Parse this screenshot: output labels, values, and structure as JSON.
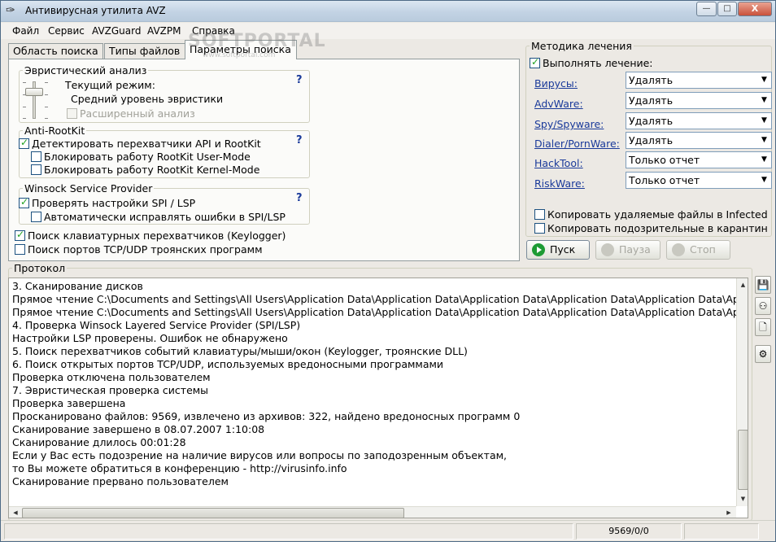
{
  "window": {
    "title": "Антивирусная утилита AVZ",
    "buttons": {
      "minimize": "—",
      "maximize": "□",
      "close": "X"
    }
  },
  "menu": {
    "items": [
      {
        "label": "Файл"
      },
      {
        "label": "Сервис"
      },
      {
        "label": "AVZGuard"
      },
      {
        "label": "AVZPM"
      },
      {
        "label": "Справка"
      }
    ]
  },
  "watermark": {
    "text": "SOFTPORTAL",
    "sub": "www.softportal.com"
  },
  "tabs": [
    {
      "label": "Область поиска",
      "active": false
    },
    {
      "label": "Типы файлов",
      "active": false
    },
    {
      "label": "Параметры поиска",
      "active": true
    }
  ],
  "heuristic": {
    "legend": "Эвристический анализ",
    "help": "?",
    "mode_label": "Текущий режим:",
    "mode_value": "Средний уровень эвристики",
    "extended": {
      "label": "Расширенный анализ",
      "checked": false,
      "disabled": true
    }
  },
  "antirootkit": {
    "legend": "Anti-RootKit",
    "help": "?",
    "detect": {
      "label": "Детектировать перехватчики API и RootKit",
      "checked": true
    },
    "block_user": {
      "label": "Блокировать работу RootKit User-Mode",
      "checked": false
    },
    "block_kernel": {
      "label": "Блокировать работу RootKit Kernel-Mode",
      "checked": false
    }
  },
  "winsock": {
    "legend": "Winsock  Service Provider",
    "help": "?",
    "check_spi": {
      "label": "Проверять настройки SPI / LSP",
      "checked": true
    },
    "auto_fix": {
      "label": "Автоматически исправлять ошибки в SPI/LSP",
      "checked": false
    }
  },
  "keylogger": {
    "label": "Поиск клавиатурных перехватчиков (Keylogger)",
    "checked": true
  },
  "trojan_ports": {
    "label": "Поиск портов TCP/UDP троянских программ",
    "checked": false
  },
  "treatment": {
    "legend": "Методика лечения",
    "perform": {
      "label": "Выполнять лечение:",
      "checked": true
    },
    "rows": [
      {
        "link": "Вирусы:",
        "action": "Удалять"
      },
      {
        "link": "AdvWare:",
        "action": "Удалять"
      },
      {
        "link": "Spy/Spyware:",
        "action": "Удалять"
      },
      {
        "link": "Dialer/PornWare:",
        "action": "Удалять"
      },
      {
        "link": "HackTool:",
        "action": "Только отчет"
      },
      {
        "link": "RiskWare:",
        "action": "Только отчет"
      }
    ],
    "copy_deleted": {
      "label": "Копировать удаляемые файлы в  Infected",
      "checked": false
    },
    "copy_suspicious": {
      "label": "Копировать подозрительные в  карантин",
      "checked": false
    }
  },
  "controls": {
    "start": "Пуск",
    "pause": "Пауза",
    "stop": "Стоп"
  },
  "protocol": {
    "legend": "Протокол",
    "lines": [
      "3. Сканирование дисков",
      "Прямое чтение C:\\Documents and Settings\\All Users\\Application Data\\Application Data\\Application Data\\Application Data\\Application Data\\Applica",
      "Прямое чтение C:\\Documents and Settings\\All Users\\Application Data\\Application Data\\Application Data\\Application Data\\Application Data\\Applica",
      "4. Проверка Winsock Layered Service Provider (SPI/LSP)",
      " Настройки LSP проверены. Ошибок не обнаружено",
      "5. Поиск перехватчиков событий клавиатуры/мыши/окон (Keylogger, троянские DLL)",
      "6. Поиск открытых портов TCP/UDP, используемых вредоносными программами",
      " Проверка отключена пользователем",
      "7. Эвристическая проверка системы",
      "Проверка завершена",
      "Просканировано файлов: 9569, извлечено из архивов: 322, найдено вредоносных программ 0",
      "Сканирование завершено в 08.07.2007 1:10:08",
      "Сканирование длилось 00:01:28",
      "Если у Вас есть подозрение на наличие вирусов или вопросы по заподозренным объектам,",
      "то Вы можете обратиться в конференцию - http://virusinfo.info",
      "Сканирование прервано пользователем"
    ]
  },
  "statusbar": {
    "counts": "9569/0/0"
  }
}
